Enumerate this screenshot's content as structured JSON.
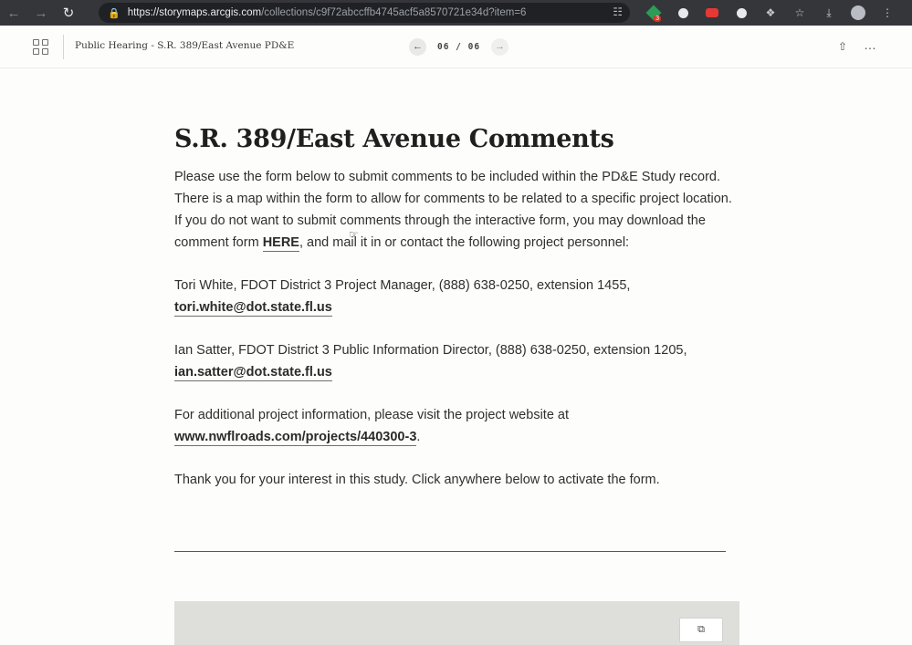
{
  "browser": {
    "url_host": "https://storymaps.arcgis.com",
    "url_path": "/collections/c9f72abccffb4745acf5a8570721e34d?item=6",
    "extension_badge": "3"
  },
  "header": {
    "title": "Public Hearing - S.R. 389/East Avenue PD&E",
    "pager_text": "06 / 06"
  },
  "content": {
    "heading": "S.R. 389/East Avenue Comments",
    "intro_before": "Please use the form below to submit comments to be included within the PD&E Study record. There is a map within the form to allow for comments to be related to a specific project location. If you do not want to submit comments through the interactive form, you may download the comment form ",
    "intro_link": "HERE",
    "intro_after": ", and mail it in or contact the following project personnel:",
    "contact1_text": "Tori White, FDOT District 3 Project Manager, (888) 638-0250, extension 1455,",
    "contact1_email": "tori.white@dot.state.fl.us",
    "contact2_text": "Ian Satter, FDOT District 3 Public Information Director, (888) 638-0250, extension 1205,",
    "contact2_email": "ian.satter@dot.state.fl.us",
    "info_text": "For additional project information, please visit the project website at",
    "info_link": "www.nwflroads.com/projects/440300-3",
    "info_after": ".",
    "thanks": "Thank you for your interest in this study. Click anywhere below to activate the form."
  },
  "icons": {
    "back": "arrow-left-icon",
    "forward": "arrow-right-icon",
    "reload": "reload-icon",
    "lock": "lock-icon",
    "grid": "grid-icon",
    "share": "share-icon",
    "more": "more-icon",
    "open_external": "open-external-icon"
  }
}
